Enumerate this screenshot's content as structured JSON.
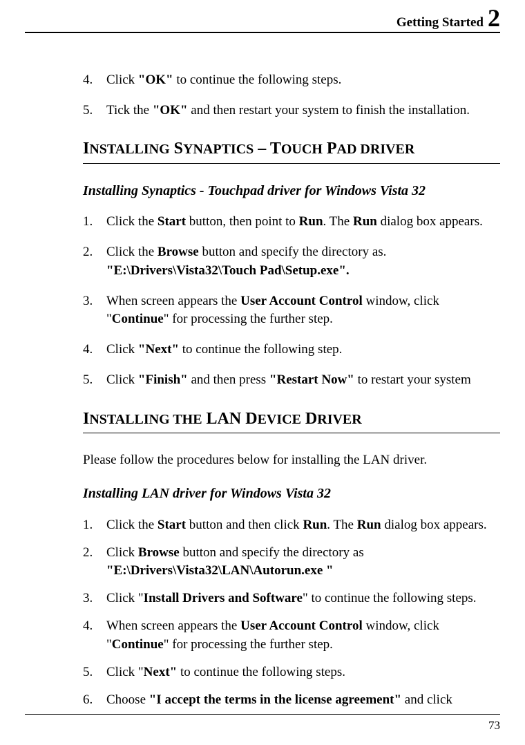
{
  "header": {
    "chapter_title": "Getting Started",
    "chapter_num": "2"
  },
  "top_list": [
    {
      "num": "4.",
      "html": "Click <b>\"OK\"</b> to continue the following steps."
    },
    {
      "num": "5.",
      "html": "Tick the <b>\"OK\"</b> and then restart your system to finish the installation."
    }
  ],
  "section1": {
    "heading_html": "<span class=\"sc-big\">I</span><span class=\"sc-small\">NSTALLING</span> <span class=\"sc-big\">S</span><span class=\"sc-small\">YNAPTICS</span> – <span class=\"sc-big\">T</span><span class=\"sc-small\">OUCH</span> <span class=\"sc-big\">P</span><span class=\"sc-small\">AD DRIVER</span>",
    "subheading": "Installing Synaptics - Touchpad driver for Windows Vista 32",
    "items": [
      {
        "num": "1.",
        "html": "Click the <b>Start</b> button, then point to <b>Run</b>. The <b>Run</b> dialog box appears."
      },
      {
        "num": "2.",
        "html": "Click the <b>Browse</b> button and specify the directory as.<br><b>\"E:\\Drivers\\Vista32\\Touch Pad\\Setup.exe\".</b>"
      },
      {
        "num": "3.",
        "html": "When screen appears the <b>User Account Control</b> window, click \"<b>Continue</b>\" for processing the further step."
      },
      {
        "num": "4.",
        "html": "Click <b>\"Next\"</b> to continue the following step."
      },
      {
        "num": "5.",
        "html": "Click <b>\"Finish\"</b> and then press <b>\"Restart Now\"</b> to restart your system"
      }
    ]
  },
  "section2": {
    "heading_html": "<span class=\"sc-big\">I</span><span class=\"sc-small\">NSTALLING THE</span> <span class=\"sc-big\">LAN D</span><span class=\"sc-small\">EVICE</span> <span class=\"sc-big\">D</span><span class=\"sc-small\">RIVER</span>",
    "intro": "Please follow the procedures below for installing the LAN driver.",
    "subheading": "Installing LAN driver for Windows Vista 32",
    "items": [
      {
        "num": "1.",
        "html": " Click the <b>Start</b> button and then click <b>Run</b>. The <b>Run</b> dialog box appears."
      },
      {
        "num": "2.",
        "html": "Click <b>Browse</b> button and specify the directory as<br><b>\"E:\\Drivers\\Vista32\\LAN\\Autorun.exe \"</b>"
      },
      {
        "num": "3.",
        "html": "Click \"<b>Install Drivers and Software</b>\" to continue the following steps."
      },
      {
        "num": "4.",
        "html": "When screen appears the <b>User Account Control</b> window, click \"<b>Continue</b>\" for processing the further step."
      },
      {
        "num": "5.",
        "html": "Click \"<b>Next\"</b> to continue the following steps."
      },
      {
        "num": "6.",
        "html": "Choose <b>\"I accept the terms in the license agreement\"</b> and click"
      }
    ]
  },
  "footer": {
    "page_num": "73"
  }
}
